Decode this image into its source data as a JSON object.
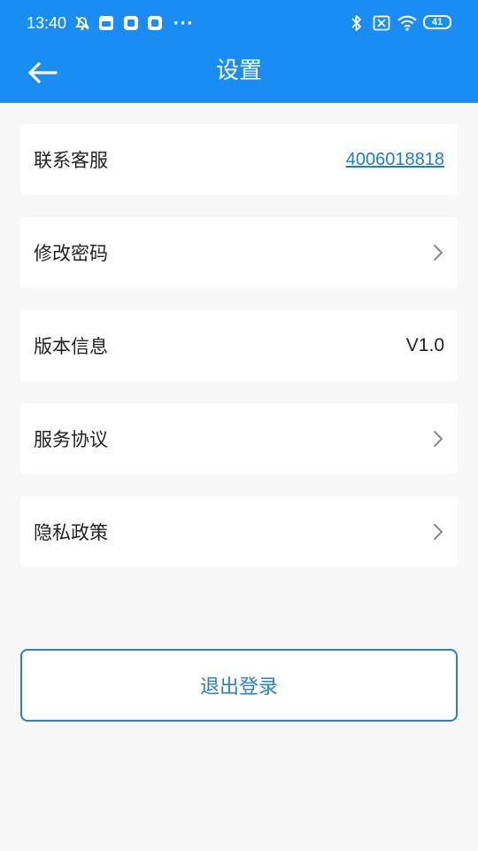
{
  "status_bar": {
    "time": "13:40",
    "battery": "41",
    "icons": [
      "alarm-off-icon",
      "app-notification-icon",
      "app-notification-icon",
      "app-notification-icon",
      "more-dots-icon",
      "bluetooth-icon",
      "sim-off-icon",
      "wifi-icon",
      "battery-icon"
    ],
    "more_dots": "···"
  },
  "nav": {
    "title": "设置",
    "back_icon": "back-arrow-icon"
  },
  "settings": {
    "items": [
      {
        "label": "联系客服",
        "value": "4006018818"
      },
      {
        "label": "修改密码",
        "icon": "chevron-right-icon"
      },
      {
        "label": "版本信息",
        "value": "V1.0"
      },
      {
        "label": "服务协议",
        "icon": "chevron-right-icon"
      },
      {
        "label": "隐私政策",
        "icon": "chevron-right-icon"
      }
    ]
  },
  "logout": {
    "label": "退出登录"
  },
  "colors": {
    "header": "#1a8df5",
    "accent": "#2b7fc7",
    "background": "#f7f7f7"
  }
}
